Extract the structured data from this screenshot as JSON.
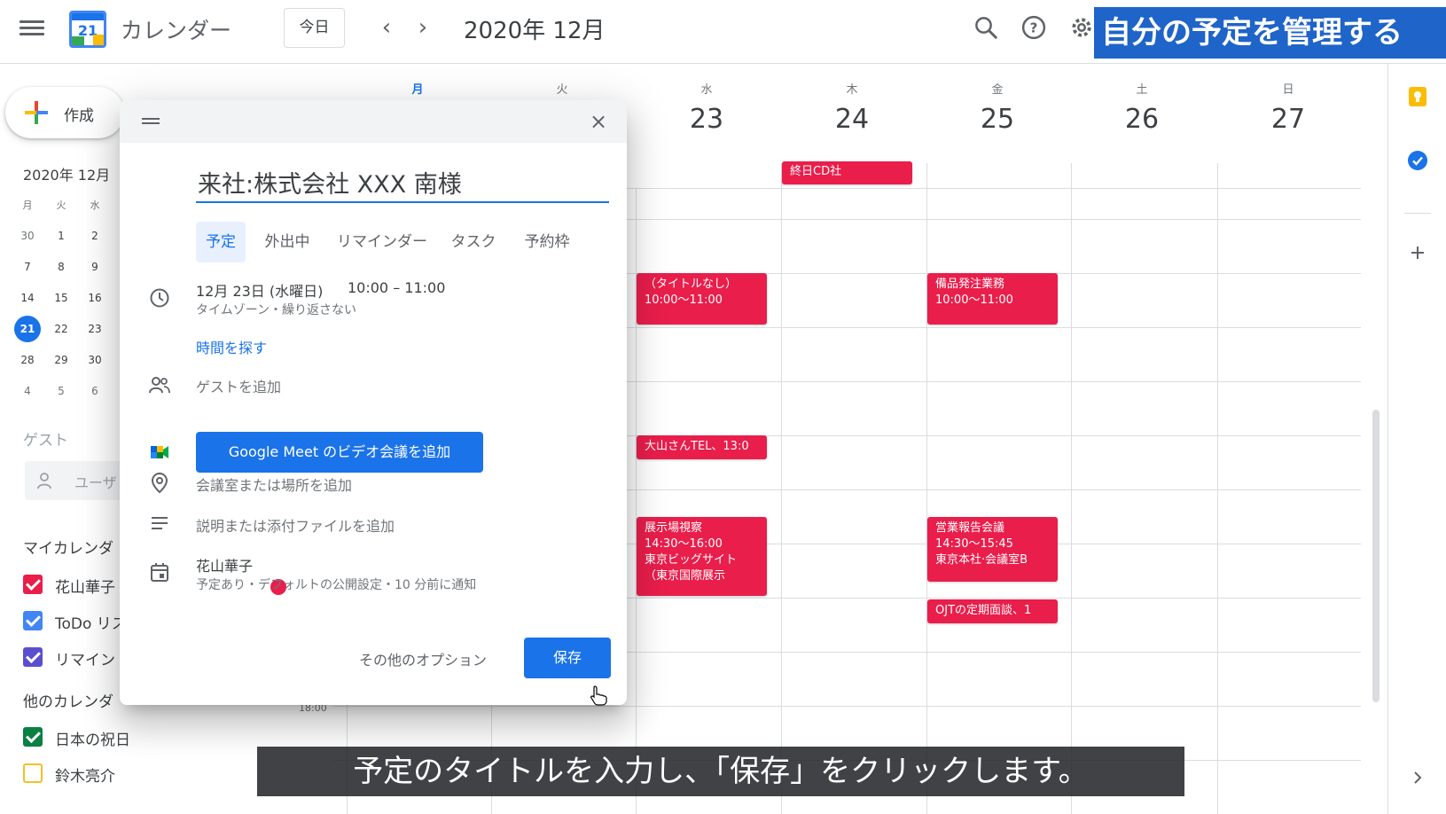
{
  "header": {
    "app_title": "カレンダー",
    "logo_number": "21",
    "today_label": "今日",
    "month_title": "2020年 12月",
    "banner": "自分の予定を管理する"
  },
  "sidebar": {
    "create_label": "作成",
    "mini_title": "2020年 12月",
    "mini_headers": [
      "月",
      "火",
      "水"
    ],
    "mini_rows": [
      [
        "30",
        "1",
        "2"
      ],
      [
        "7",
        "8",
        "9"
      ],
      [
        "14",
        "15",
        "16"
      ],
      [
        "21",
        "22",
        "23"
      ],
      [
        "28",
        "29",
        "30"
      ],
      [
        "4",
        "5",
        "6"
      ]
    ],
    "guest_label": "ゲスト",
    "guest_search": "ユーザ",
    "my_calendars_label": "マイカレンダ",
    "my_calendars": [
      {
        "name": "花山華子",
        "color": "#e91e4b"
      },
      {
        "name": "ToDo リス",
        "color": "#4285f4"
      },
      {
        "name": "リマイン",
        "color": "#5b4fcf"
      }
    ],
    "other_calendars_label": "他のカレンダ",
    "other_calendars": [
      {
        "name": "日本の祝日",
        "color": "#0b8043",
        "checked": true
      },
      {
        "name": "鈴木亮介",
        "color": "#f6bf26",
        "checked": false
      }
    ]
  },
  "week": {
    "days": [
      {
        "dow": "月",
        "num": ""
      },
      {
        "dow": "火",
        "num": ""
      },
      {
        "dow": "水",
        "num": "23"
      },
      {
        "dow": "木",
        "num": "24"
      },
      {
        "dow": "金",
        "num": "25"
      },
      {
        "dow": "土",
        "num": "26"
      },
      {
        "dow": "日",
        "num": "27"
      }
    ],
    "time_label_18": "18:00",
    "events": {
      "allday_thu": "終日CD社",
      "wed_1": {
        "title": "（タイトルなし）",
        "time": "10:00～11:00"
      },
      "fri_1": {
        "title": "備品発注業務",
        "time": "10:00～11:00"
      },
      "wed_2": "大山さんTEL、13:0",
      "wed_3": {
        "title": "展示場視察",
        "time": "14:30～16:00",
        "loc": "東京ビッグサイト",
        "loc2": "（東京国際展示"
      },
      "fri_2": {
        "title": "営業報告会議",
        "time": "14:30～15:45",
        "loc": "東京本社·会議室B"
      },
      "fri_3": "OJTの定期面談、1"
    }
  },
  "dialog": {
    "title_value": "来社:株式会社 XXX 南様",
    "tabs": [
      "予定",
      "外出中",
      "リマインダー",
      "タスク",
      "予約枠"
    ],
    "date": "12月 23日 (水曜日)",
    "time": "10:00 – 11:00",
    "tz_repeat": "タイムゾーン・繰り返さない",
    "find_time": "時間を探す",
    "add_guests": "ゲストを追加",
    "meet_button": "Google Meet のビデオ会議を追加",
    "add_location": "会議室または場所を追加",
    "add_description": "説明または添付ファイルを追加",
    "calendar_owner": "花山華子",
    "calendar_details": "予定あり・デフォルトの公開設定・10 分前に通知",
    "more_options": "その他のオプション",
    "save": "保存"
  },
  "caption": "予定のタイトルを入力し、「保存」をクリックします。"
}
